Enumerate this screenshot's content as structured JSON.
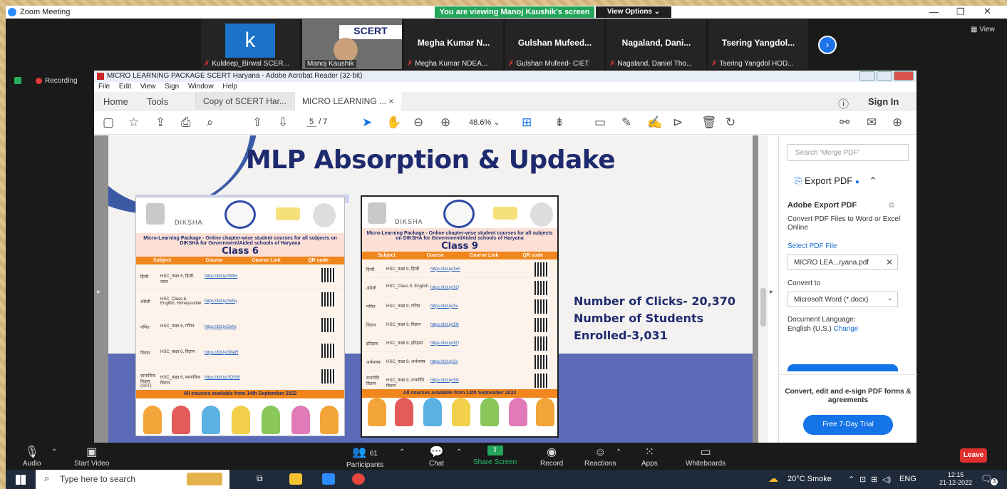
{
  "zoom": {
    "window_title": "Zoom Meeting",
    "viewing_banner": "You are viewing Manoj Kaushik's screen",
    "view_options": "View Options ⌄",
    "view_button": "View",
    "recording": "Recording",
    "participants_thumbs": [
      {
        "name": "Kuldeep_Birwal SCER...",
        "avatar": "k"
      },
      {
        "name": "Manoj Kaushik",
        "avatar": "SCERT"
      },
      {
        "big": "Megha Kumar N...",
        "name": "Megha Kumar NDEA..."
      },
      {
        "big": "Gulshan Mufeed...",
        "name": "Gulshan Mufeed- CIET"
      },
      {
        "big": "Nagaland, Dani...",
        "name": "Nagaland, Daniel Tho..."
      },
      {
        "big": "Tsering Yangdol...",
        "name": "Tsering Yangdol HOD..."
      }
    ],
    "toolbar": {
      "audio": "Audio",
      "start_video": "Start Video",
      "participants": "Participants",
      "participant_count": "61",
      "chat": "Chat",
      "share_screen": "Share Screen",
      "record": "Record",
      "reactions": "Reactions",
      "apps": "Apps",
      "whiteboards": "Whiteboards",
      "leave": "Leave"
    },
    "colors": {
      "banner": "#23a55a",
      "leave": "#e02f2f",
      "share": "#23a55a"
    }
  },
  "acrobat": {
    "title": "MICRO LEARNING PACKAGE SCERT Haryana - Adobe Acrobat Reader (32-bit)",
    "menu": [
      "File",
      "Edit",
      "View",
      "Sign",
      "Window",
      "Help"
    ],
    "nav": {
      "home": "Home",
      "tools": "Tools"
    },
    "tabs": [
      {
        "label": "Copy of SCERT Har..."
      },
      {
        "label": "MICRO LEARNING ...",
        "close": "×"
      }
    ],
    "sign_in": "Sign In",
    "page_current": "5",
    "page_total": "/ 7",
    "zoom_level": "48.6%",
    "right_panel": {
      "search_placeholder": "Search 'Merge PDF'",
      "export_pdf": "Export PDF",
      "adobe_export_title": "Adobe Export PDF",
      "adobe_export_desc": "Convert PDF Files to Word or Excel Online",
      "select_file": "Select PDF File",
      "file_name": "MICRO LEA...ryana.pdf",
      "convert_to": "Convert to",
      "format": "Microsoft Word (*.docx)",
      "doc_lang_label": "Document Language:",
      "doc_lang_value": "English (U.S.)",
      "change": "Change",
      "promo_text": "Convert, edit and e-sign PDF forms & agreements",
      "trial_button": "Free 7-Day Trial"
    }
  },
  "slide": {
    "title": "MLP Absorption & Updake",
    "stats_line1": "Number of Clicks- 20,370",
    "stats_line2": "Number of Students",
    "stats_line3": "Enrolled-3,031",
    "poster_left": {
      "diksha": "DIKSHA",
      "subtitle": "Micro-Learning Package - Online chapter-wise student courses for all subjects on DIKSHA for Government/Aided schools of Haryana",
      "class": "Class 6",
      "headers": [
        "Subject",
        "Course",
        "Course Link",
        "QR code"
      ],
      "rows": [
        {
          "subject": "हिन्दी",
          "course": "HSC_कक्षा 6, हिन्दी, वसंत",
          "link": "https://bit.ly/3Nfm"
        },
        {
          "subject": "अंग्रेज़ी",
          "course": "HSC_Class 6, English, Honeysuckle",
          "link": "https://bit.ly/3xhq"
        },
        {
          "subject": "गणित",
          "course": "HSC_कक्षा 6, गणित",
          "link": "https://bit.ly/3xhs"
        },
        {
          "subject": "विज्ञान",
          "course": "HSC_कक्षा 6, विज्ञान",
          "link": "https://bit.ly/3NeR"
        },
        {
          "subject": "सामाजिक विज्ञान (SST)",
          "course": "HSC_कक्षा 6, सामाजिक विज्ञान",
          "link": "https://bit.ly/3QSW"
        }
      ],
      "footer": "All courses available from 14th September 2022"
    },
    "poster_right": {
      "diksha": "DIKSHA",
      "subtitle": "Micro-Learning Package - Online chapter-wise student courses for all subjects on DIKSHA for Government/Aided schools of Haryana",
      "class": "Class 9",
      "headers": [
        "Subject",
        "Course",
        "Course Link",
        "QR code"
      ],
      "rows": [
        {
          "subject": "हिन्दी",
          "course": "HSC_कक्षा 9, हिन्दी",
          "link": "https://bit.ly/3xh"
        },
        {
          "subject": "अंग्रेज़ी",
          "course": "HSC_Class 9, English",
          "link": "https://bit.ly/3Q"
        },
        {
          "subject": "गणित",
          "course": "HSC_कक्षा 9, गणित",
          "link": "https://bit.ly/3x"
        },
        {
          "subject": "विज्ञान",
          "course": "HSC_कक्षा 9, विज्ञान",
          "link": "https://bit.ly/3N"
        },
        {
          "subject": "इतिहास",
          "course": "HSC_कक्षा 9, इतिहास",
          "link": "https://bit.ly/3Q"
        },
        {
          "subject": "अर्थशास्त्र",
          "course": "HSC_कक्षा 9, अर्थशास्त्र",
          "link": "https://bit.ly/3x"
        },
        {
          "subject": "राजनीति विज्ञान",
          "course": "HSC_कक्षा 9, राजनीति विज्ञान",
          "link": "https://bit.ly/3N"
        }
      ],
      "footer": "All courses available from 14th September 2022"
    }
  },
  "taskbar": {
    "search": "Type here to search",
    "weather": "20°C  Smoke",
    "lang": "ENG",
    "time": "12:15",
    "date": "21-12-2022",
    "notif_count": "3"
  }
}
